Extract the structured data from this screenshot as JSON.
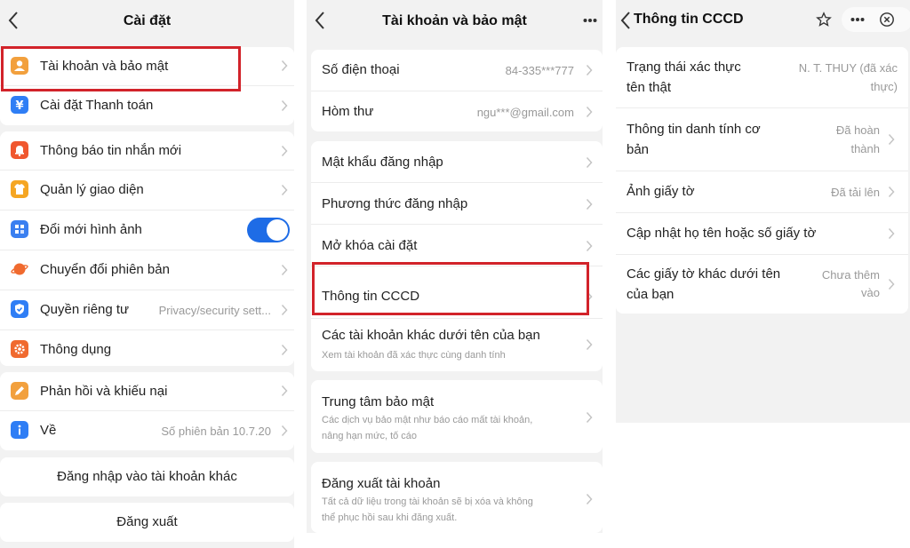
{
  "settings": {
    "title": "Cài đặt",
    "items": [
      {
        "label": "Tài khoản và bảo mật"
      },
      {
        "label": "Cài đặt Thanh toán"
      },
      {
        "label": "Thông báo tin nhắn mới"
      },
      {
        "label": "Quản lý giao diện"
      },
      {
        "label": "Đổi mới hình ảnh"
      },
      {
        "label": "Chuyển đổi phiên bản"
      },
      {
        "label": "Quyền riêng tư",
        "value": "Privacy/security sett..."
      },
      {
        "label": "Thông dụng"
      },
      {
        "label": "Phản hồi và khiếu nại"
      },
      {
        "label": "Về",
        "value": "Số phiên bản 10.7.20"
      }
    ],
    "switch_account": "Đăng nhập vào tài khoản khác",
    "logout": "Đăng xuất",
    "toggle_on": true,
    "icon_colors": [
      "#f2a03d",
      "#2f7ef5",
      "#f0572f",
      "#f5a623",
      "#3a7ff0",
      "#f06a2f",
      "#2f7ef5",
      "#f06a2f",
      "#f2a03d",
      "#2f7ef5"
    ],
    "accent": "#1e6ce6",
    "highlight": "#d2232a"
  },
  "account": {
    "title": "Tài khoản và bảo mật",
    "phone_label": "Số điện thoại",
    "phone_value": "84-335***777",
    "email_label": "Hòm thư",
    "email_value": "ngu***@gmail.com",
    "password_label": "Mật khẩu đăng nhập",
    "login_method_label": "Phương thức đăng nhập",
    "unlock_label": "Mở khóa cài đặt",
    "cccd_label": "Thông tin CCCD",
    "other_accounts_label": "Các tài khoản khác dưới tên của bạn",
    "other_accounts_sub": "Xem tài khoản đã xác thực cùng danh tính",
    "security_label": "Trung tâm bảo mật",
    "security_sub_1": "Các dịch vụ bảo mật như báo cáo mất tài khoản,",
    "security_sub_2": "nâng hạn mức, tố cáo",
    "delete_label": "Đăng xuất tài khoản",
    "delete_sub_1": "Tất cả dữ liệu trong tài khoản sẽ bị xóa và không",
    "delete_sub_2": "thể phục hồi sau khi đăng xuất."
  },
  "cccd": {
    "title": "Thông tin CCCD",
    "verify_label_1": "Trạng thái xác thực",
    "verify_label_2": "tên thật",
    "verify_value_1": "N. T. THUY (đã xác",
    "verify_value_2": "thực)",
    "identity_label_1": "Thông tin danh tính cơ",
    "identity_label_2": "bản",
    "identity_value_1": "Đã hoàn",
    "identity_value_2": "thành",
    "photo_label": "Ảnh giấy tờ",
    "photo_value": "Đã tải lên",
    "update_label": "Cập nhật họ tên hoặc số giấy tờ",
    "other_docs_label_1": "Các giấy tờ khác dưới tên",
    "other_docs_label_2": "của bạn",
    "other_docs_value_1": "Chưa thêm",
    "other_docs_value_2": "vào"
  }
}
